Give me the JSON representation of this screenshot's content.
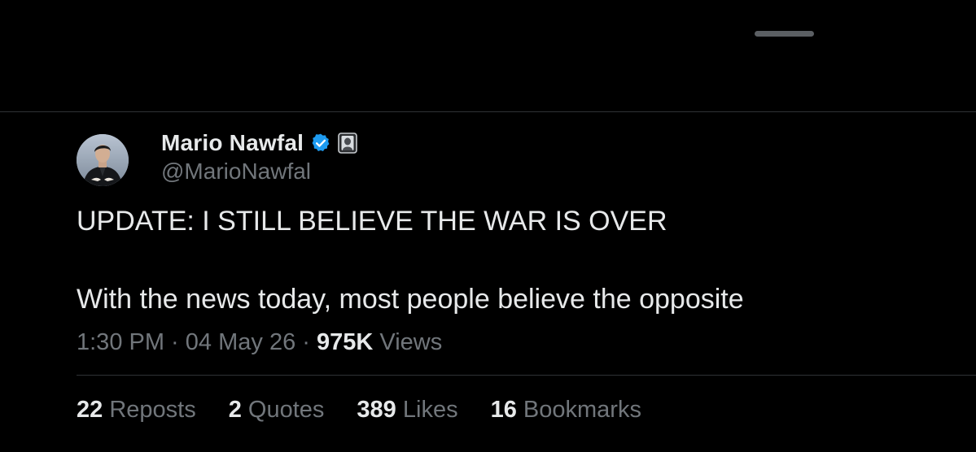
{
  "tweet": {
    "author": {
      "display_name": "Mario Nawfal",
      "handle": "@MarioNawfal",
      "verified_icon": "verified-badge-icon",
      "affiliate_icon": "affiliate-badge-icon"
    },
    "text_lines": [
      "UPDATE: I STILL BELIEVE THE WAR IS OVER",
      "With the news today, most people believe the opposite"
    ],
    "meta": {
      "time": "1:30 PM",
      "separator": " · ",
      "date": "04 May 26",
      "views_count": "975K",
      "views_label": " Views"
    },
    "stats": {
      "reposts": {
        "count": "22",
        "label": " Reposts"
      },
      "quotes": {
        "count": "2",
        "label": " Quotes"
      },
      "likes": {
        "count": "389",
        "label": " Likes"
      },
      "bookmarks": {
        "count": "16",
        "label": " Bookmarks"
      }
    }
  },
  "colors": {
    "background": "#000000",
    "primary_text": "#e7e9ea",
    "secondary_text": "#71767b",
    "divider": "#2f3336",
    "verified_blue": "#1d9bf0"
  }
}
